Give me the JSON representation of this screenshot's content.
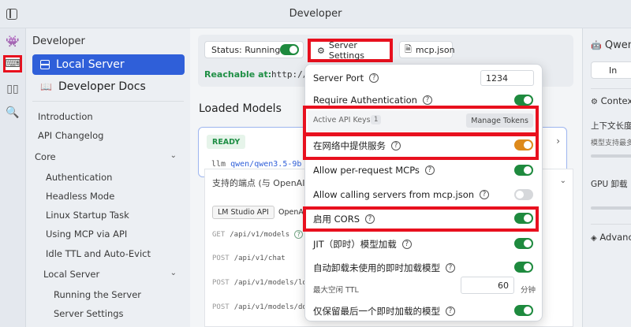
{
  "window": {
    "title": "Developer"
  },
  "sidebar": {
    "heading": "Developer",
    "local_server": "Local Server",
    "developer_docs": "Developer Docs",
    "items": [
      {
        "label": "Introduction",
        "level": 0
      },
      {
        "label": "API Changelog",
        "level": 0
      },
      {
        "label": "Core",
        "level": 0,
        "expandable": true
      },
      {
        "label": "Authentication",
        "level": 1
      },
      {
        "label": "Headless Mode",
        "level": 1
      },
      {
        "label": "Linux Startup Task",
        "level": 1
      },
      {
        "label": "Using MCP via API",
        "level": 1
      },
      {
        "label": "Idle TTL and Auto-Evict",
        "level": 1
      },
      {
        "label": "Local Server",
        "level": 1,
        "expandable": true
      },
      {
        "label": "Running the Server",
        "level": 2
      },
      {
        "label": "Server Settings",
        "level": 2
      }
    ]
  },
  "toolbar": {
    "status_label": "Status: Running",
    "status_on": true,
    "server_settings_label": "Server Settings",
    "mcp_json_label": "mcp.json",
    "reachable_label": "Reachable at:",
    "reachable_url": "http://"
  },
  "main": {
    "loaded_models_heading": "Loaded Models",
    "model_state": "READY",
    "model_prefix": "llm",
    "model_name": "qwen/qwen3.5-9b",
    "endpoints_heading": "支持的端点 (与 OpenAI 兼",
    "tabs": [
      "LM Studio API",
      "OpenAI-"
    ],
    "endpoints": [
      {
        "verb": "GET",
        "path": "/api/v1/models"
      },
      {
        "verb": "POST",
        "path": "/api/v1/chat"
      },
      {
        "verb": "POST",
        "path": "/api/v1/models/lo"
      },
      {
        "verb": "POST",
        "path": "/api/v1/models/do"
      }
    ]
  },
  "right_panel": {
    "title": "Qwen",
    "box": "In",
    "context_heading": "Context",
    "context_label": "上下文长度",
    "context_sub": "模型支持最多",
    "gpu_label": "GPU 卸载",
    "advanced_heading": "Advanced"
  },
  "settings_popup": {
    "server_port_label": "Server Port",
    "server_port_value": "1234",
    "require_auth_label": "Require Authentication",
    "require_auth_on": true,
    "api_keys_label": "Active API Keys:",
    "api_keys_count": "1",
    "manage_tokens_label": "Manage Tokens",
    "serve_network_label": "在网络中提供服务",
    "serve_network_on": true,
    "per_request_mcps_label": "Allow per-request MCPs",
    "per_request_mcps_on": true,
    "calling_servers_label": "Allow calling servers from mcp.json",
    "calling_servers_on": false,
    "cors_label": "启用 CORS",
    "cors_on": true,
    "jit_label": "JIT（即时）模型加载",
    "jit_on": true,
    "auto_unload_label": "自动卸载未使用的即时加载模型",
    "auto_unload_on": true,
    "idle_ttl_label": "最大空闲 TTL",
    "idle_ttl_value": "60",
    "idle_ttl_unit": "分钟",
    "keep_last_label": "仅保留最后一个即时加载的模型",
    "keep_last_on": true
  },
  "colors": {
    "accent": "#2f5fd9",
    "toggle_on": "#1e8a3e",
    "toggle_warn": "#dd8a1c",
    "highlight": "#e8101e"
  }
}
